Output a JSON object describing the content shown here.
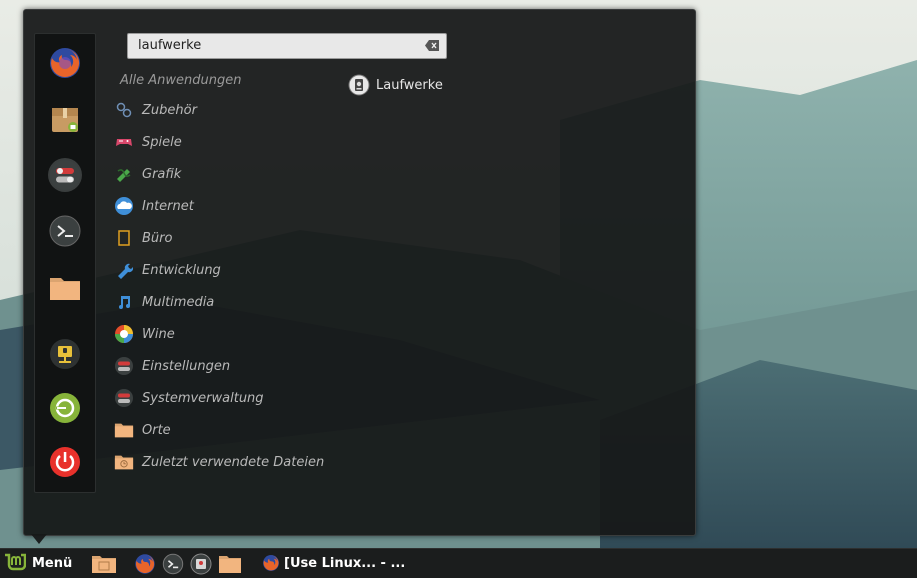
{
  "search": {
    "value": "laufwerke"
  },
  "categories": {
    "header": "Alle Anwendungen",
    "items": [
      {
        "label": "Zubehör"
      },
      {
        "label": "Spiele"
      },
      {
        "label": "Grafik"
      },
      {
        "label": "Internet"
      },
      {
        "label": "Büro"
      },
      {
        "label": "Entwicklung"
      },
      {
        "label": "Multimedia"
      },
      {
        "label": "Wine"
      },
      {
        "label": "Einstellungen"
      },
      {
        "label": "Systemverwaltung"
      },
      {
        "label": "Orte"
      },
      {
        "label": "Zuletzt verwendete  Dateien"
      }
    ]
  },
  "results": [
    {
      "label": "Laufwerke"
    }
  ],
  "favorites": [
    "firefox-icon",
    "package-icon",
    "settings-toggle-icon",
    "terminal-icon",
    "folder-icon",
    "lock-screen-icon",
    "logout-icon",
    "power-icon"
  ],
  "panel": {
    "menu_label": "Menü",
    "task_label": "[Use Linux... - ..."
  },
  "colors": {
    "mint": "#87b43a",
    "power": "#e8312b",
    "folder": "#f2b57f",
    "panel": "#1b1d1d"
  }
}
